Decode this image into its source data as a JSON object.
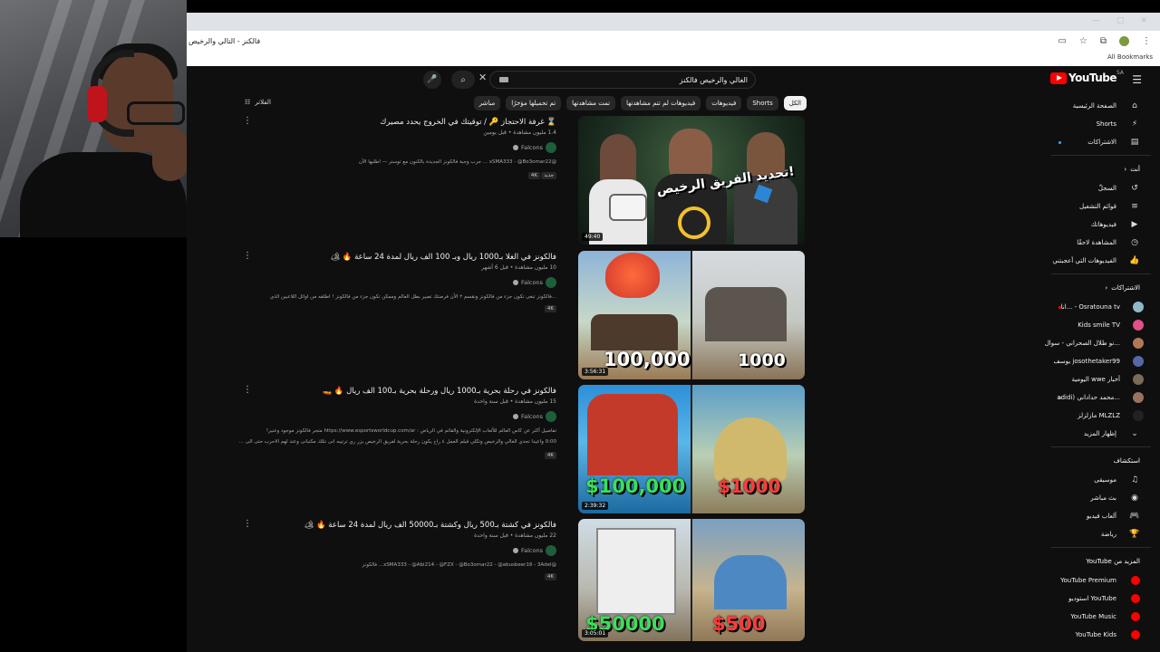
{
  "browser": {
    "url": "فالكنز - التالي والرخيص",
    "bookmarks_all": "All Bookmarks",
    "window_controls": [
      "—",
      "▢",
      "✕"
    ]
  },
  "youtube": {
    "logo_text": "YouTube",
    "logo_region": "SA",
    "search_query": "الغالي والرخيص فالكنز",
    "filters_label": "الفلاتر",
    "chips": [
      "الكل",
      "Shorts",
      "فيديوهات",
      "فيديوهات لم تتم مشاهدتها",
      "تمت مشاهدتها",
      "تم تحميلها مؤخرًا",
      "مباشر"
    ],
    "sidebar": {
      "main": [
        {
          "label": "الصفحة الرئيسية",
          "icon": "home-icon",
          "glyph": "⌂"
        },
        {
          "label": "Shorts",
          "icon": "shorts-icon",
          "glyph": "⚡"
        },
        {
          "label": "الاشتراكات",
          "icon": "subscriptions-icon",
          "glyph": "▤"
        }
      ],
      "you_label": "أنت",
      "you": [
        {
          "label": "السجلّ",
          "icon": "history-icon",
          "glyph": "↺"
        },
        {
          "label": "قوائم التشغيل",
          "icon": "playlists-icon",
          "glyph": "≡"
        },
        {
          "label": "فيديوهاتك",
          "icon": "your-videos-icon",
          "glyph": "▶"
        },
        {
          "label": "المشاهدة لاحقًا",
          "icon": "watch-later-icon",
          "glyph": "◷"
        },
        {
          "label": "الفيديوهات التي أعجبتني",
          "icon": "liked-icon",
          "glyph": "👍"
        }
      ],
      "subs_label": "الاشتراكات",
      "subscriptions": [
        {
          "label": "Osratouna tv - ...انا",
          "color": "#8fb8c9",
          "live": true
        },
        {
          "label": "Kids smile TV",
          "color": "#e0508a"
        },
        {
          "label": "...نو طلال الصحراني - سوال",
          "color": "#b07858"
        },
        {
          "label": "josothetaker99 يوسف",
          "color": "#5468a8"
        },
        {
          "label": "أخبار wwe اليومية",
          "color": "#7a6a58"
        },
        {
          "label": "...محمد حداداني (adidi",
          "color": "#9a7260",
          "dot": true
        },
        {
          "label": "MLZLZ مازلزلز",
          "color": "#222222"
        }
      ],
      "show_more": "إظهار المزيد",
      "explore_label": "استكشاف",
      "explore": [
        {
          "label": "موسيقى",
          "icon": "music-icon",
          "glyph": "♫"
        },
        {
          "label": "بث مباشر",
          "icon": "live-icon",
          "glyph": "◉"
        },
        {
          "label": "ألعاب فيديو",
          "icon": "gaming-icon",
          "glyph": "🎮"
        },
        {
          "label": "رياضة",
          "icon": "sports-icon",
          "glyph": "🏆"
        }
      ],
      "more_label": "المزيد من YouTube",
      "more": [
        {
          "label": "YouTube Premium"
        },
        {
          "label": "YouTube استوديو"
        },
        {
          "label": "YouTube Music"
        },
        {
          "label": "YouTube Kids"
        }
      ]
    },
    "results": [
      {
        "title": "⌛ غرفة الاحتجاز 🔑 / توقيتك في الخروج يحدد مصيرك",
        "meta": "1.4 مليون مشاهدة • قبل يومين",
        "channel": "Falcons",
        "desc": "@xSMA333 - @Bo3omar22 ... جرب وجبة فالكونز الجديدة بالكنون مع توستر — اطلبها الآن",
        "badges": [
          "4K",
          "جديد"
        ],
        "duration": "49:40",
        "thumb_text": "تحديد الفريق الرخيص!"
      },
      {
        "title": "فالكونز في الغلا بـ1000 ريال وبـ 100 الف ريال لمدة 24 ساعة 🔥 🏕",
        "meta": "10 مليون مشاهدة • قبل 6 أشهر",
        "channel": "Falcons",
        "desc": "...فالكونز تبغى تكون جزء من فالكونز ونقسم ٢ الأن فرصتك تصير بطل العالم وممكن تكون جزء من فالكونز ! اطلقه من اوائل اللاعبين الذي",
        "badges": [
          "4K"
        ],
        "duration": "3:56:31",
        "thumb_left": "100,000",
        "thumb_right": "1000"
      },
      {
        "title": "فالكونز في رحلة بحرية بـ1000 ريال ورحلة بحرية بـ100 الف ريال 🔥 🚤",
        "meta": "15 مليون مشاهدة • قبل سنة واحدة",
        "channel": "Falcons",
        "desc": "تفاصيل أكثر عن كاس العالم للألعاب الإلكترونية والقائم في الرياض : https://www.esportsworldcup.com/ar متجر فالكونز موجود وعنير!",
        "desc2": "0:00 واعيدا تحدي الغالي والرخيص وتكلي فيلم العمل ٤ راح يكون رحلة بحرية لفريق الرخيص بزر ري ترتيبه انى نثلك مكتبانى وعند لهم الاحرب حتى الى ...",
        "badges": [
          "4K"
        ],
        "duration": "2:39:32",
        "thumb_left": "$100,000",
        "thumb_right": "$1000"
      },
      {
        "title": "فالكونز في كشتة بـ500 ريال وكشتة بـ50000 الف ريال لمدة 24 ساعة 🔥 🏕",
        "meta": "22 مليون مشاهدة • قبل سنة واحدة",
        "channel": "Falcons",
        "desc": "@xSMA333 - @Abi214 - @FZX - @Bo3omar22 - @abusbeer16 - 3Adel... فالكونز",
        "badges": [
          "4K"
        ],
        "duration": "3:05:01",
        "thumb_left": "$50000",
        "thumb_right": "$500"
      }
    ]
  }
}
